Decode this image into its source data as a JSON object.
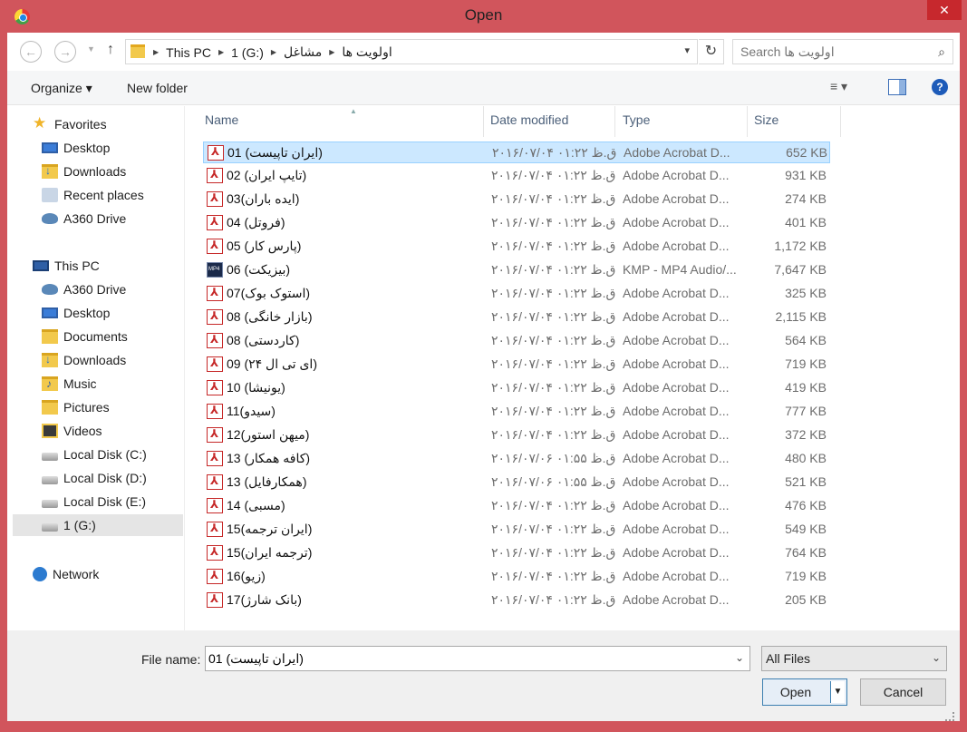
{
  "window": {
    "title": "Open",
    "close_label": "✕"
  },
  "address": {
    "crumbs": [
      "This PC",
      "1 (G:)",
      "مشاغل",
      "اولویت ها"
    ],
    "search_placeholder": "Search اولویت ها"
  },
  "toolbar": {
    "organize": "Organize ▾",
    "new_folder": "New folder",
    "view_icon": "≡ ▾",
    "help": "?"
  },
  "nav": {
    "favorites_header": "Favorites",
    "favorites": [
      "Desktop",
      "Downloads",
      "Recent places",
      "A360 Drive"
    ],
    "thispc_header": "This PC",
    "thispc": [
      "A360 Drive",
      "Desktop",
      "Documents",
      "Downloads",
      "Music",
      "Pictures",
      "Videos",
      "Local Disk (C:)",
      "Local Disk (D:)",
      "Local Disk (E:)",
      "1 (G:)"
    ],
    "network": "Network"
  },
  "columns": {
    "name": "Name",
    "date": "Date modified",
    "type": "Type",
    "size": "Size"
  },
  "files": [
    {
      "name": "01 (ایران تاپیست)",
      "date": "۲۰۱۶/۰۷/۰۴ ق.ظ ۰۱:۲۲",
      "type": "Adobe Acrobat D...",
      "size": "652 KB",
      "icon": "pdf-icon"
    },
    {
      "name": "02 (تایپ ایران)",
      "date": "۲۰۱۶/۰۷/۰۴ ق.ظ ۰۱:۲۲",
      "type": "Adobe Acrobat D...",
      "size": "931 KB",
      "icon": "pdf-icon"
    },
    {
      "name": "03(ایده باران)",
      "date": "۲۰۱۶/۰۷/۰۴ ق.ظ ۰۱:۲۲",
      "type": "Adobe Acrobat D...",
      "size": "274 KB",
      "icon": "pdf-icon"
    },
    {
      "name": "04 (فروتل)",
      "date": "۲۰۱۶/۰۷/۰۴ ق.ظ ۰۱:۲۲",
      "type": "Adobe Acrobat D...",
      "size": "401 KB",
      "icon": "pdf-icon"
    },
    {
      "name": "05 (پارس کار)",
      "date": "۲۰۱۶/۰۷/۰۴ ق.ظ ۰۱:۲۲",
      "type": "Adobe Acrobat D...",
      "size": "1,172 KB",
      "icon": "pdf-icon"
    },
    {
      "name": "06 (بیزیکت)",
      "date": "۲۰۱۶/۰۷/۰۴ ق.ظ ۰۱:۲۲",
      "type": "KMP - MP4 Audio/...",
      "size": "7,647 KB",
      "icon": "mp4-icon"
    },
    {
      "name": "07(استوک بوک)",
      "date": "۲۰۱۶/۰۷/۰۴ ق.ظ ۰۱:۲۲",
      "type": "Adobe Acrobat D...",
      "size": "325 KB",
      "icon": "pdf-icon"
    },
    {
      "name": "08 (بازار خانگی)",
      "date": "۲۰۱۶/۰۷/۰۴ ق.ظ ۰۱:۲۲",
      "type": "Adobe Acrobat D...",
      "size": "2,115 KB",
      "icon": "pdf-icon"
    },
    {
      "name": "08 (کاردستی)",
      "date": "۲۰۱۶/۰۷/۰۴ ق.ظ ۰۱:۲۲",
      "type": "Adobe Acrobat D...",
      "size": "564 KB",
      "icon": "pdf-icon"
    },
    {
      "name": "09 (ای تی ال ۲۴)",
      "date": "۲۰۱۶/۰۷/۰۴ ق.ظ ۰۱:۲۲",
      "type": "Adobe Acrobat D...",
      "size": "719 KB",
      "icon": "pdf-icon"
    },
    {
      "name": "10 (یونیشا)",
      "date": "۲۰۱۶/۰۷/۰۴ ق.ظ ۰۱:۲۲",
      "type": "Adobe Acrobat D...",
      "size": "419 KB",
      "icon": "pdf-icon"
    },
    {
      "name": "11(سیدو)",
      "date": "۲۰۱۶/۰۷/۰۴ ق.ظ ۰۱:۲۲",
      "type": "Adobe Acrobat D...",
      "size": "777 KB",
      "icon": "pdf-icon"
    },
    {
      "name": "12(میهن استور)",
      "date": "۲۰۱۶/۰۷/۰۴ ق.ظ ۰۱:۲۲",
      "type": "Adobe Acrobat D...",
      "size": "372 KB",
      "icon": "pdf-icon"
    },
    {
      "name": "13 (کافه همکار)",
      "date": "۲۰۱۶/۰۷/۰۶ ق.ظ ۰۱:۵۵",
      "type": "Adobe Acrobat D...",
      "size": "480 KB",
      "icon": "pdf-icon"
    },
    {
      "name": "13 (همکارفایل)",
      "date": "۲۰۱۶/۰۷/۰۶ ق.ظ ۰۱:۵۵",
      "type": "Adobe Acrobat D...",
      "size": "521 KB",
      "icon": "pdf-icon"
    },
    {
      "name": "14 (مسبی)",
      "date": "۲۰۱۶/۰۷/۰۴ ق.ظ ۰۱:۲۲",
      "type": "Adobe Acrobat D...",
      "size": "476 KB",
      "icon": "pdf-icon"
    },
    {
      "name": "15(ایران ترجمه)",
      "date": "۲۰۱۶/۰۷/۰۴ ق.ظ ۰۱:۲۲",
      "type": "Adobe Acrobat D...",
      "size": "549 KB",
      "icon": "pdf-icon"
    },
    {
      "name": "15(ترجمه ایران)",
      "date": "۲۰۱۶/۰۷/۰۴ ق.ظ ۰۱:۲۲",
      "type": "Adobe Acrobat D...",
      "size": "764 KB",
      "icon": "pdf-icon"
    },
    {
      "name": "16(زیو)",
      "date": "۲۰۱۶/۰۷/۰۴ ق.ظ ۰۱:۲۲",
      "type": "Adobe Acrobat D...",
      "size": "719 KB",
      "icon": "pdf-icon"
    },
    {
      "name": "17(بانک شارژ)",
      "date": "۲۰۱۶/۰۷/۰۴ ق.ظ ۰۱:۲۲",
      "type": "Adobe Acrobat D...",
      "size": "205 KB",
      "icon": "pdf-icon"
    }
  ],
  "bottom": {
    "file_name_label": "File name:",
    "file_name_value": "01 (ایران تاپیست)",
    "filter": "All Files",
    "open": "Open",
    "cancel": "Cancel"
  }
}
